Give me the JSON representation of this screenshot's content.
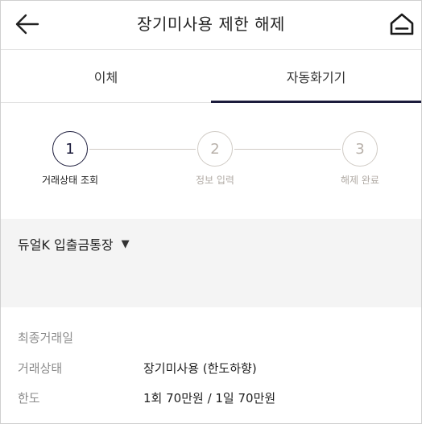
{
  "header": {
    "title": "장기미사용 제한 해제",
    "back_icon": "arrow-left-icon",
    "home_icon": "home-icon"
  },
  "tabs": [
    {
      "label": "이체",
      "active": false
    },
    {
      "label": "자동화기기",
      "active": true
    }
  ],
  "stepper": {
    "steps": [
      {
        "number": "1",
        "label": "거래상태 조회",
        "active": true
      },
      {
        "number": "2",
        "label": "정보 입력",
        "active": false
      },
      {
        "number": "3",
        "label": "해제 완료",
        "active": false
      }
    ]
  },
  "account": {
    "selected": "듀얼K 입출금통장",
    "caret_icon": "triangle-down-icon"
  },
  "info": {
    "rows": [
      {
        "label": "최종거래일",
        "value": ""
      },
      {
        "label": "거래상태",
        "value": "장기미사용 (한도하향)"
      },
      {
        "label": "한도",
        "value": "1회 70만원 / 1일 70만원"
      }
    ]
  },
  "colors": {
    "accent": "#1c1c3c",
    "inactive_step": "#d0cbc5",
    "panel_bg": "#f4f4f4"
  }
}
